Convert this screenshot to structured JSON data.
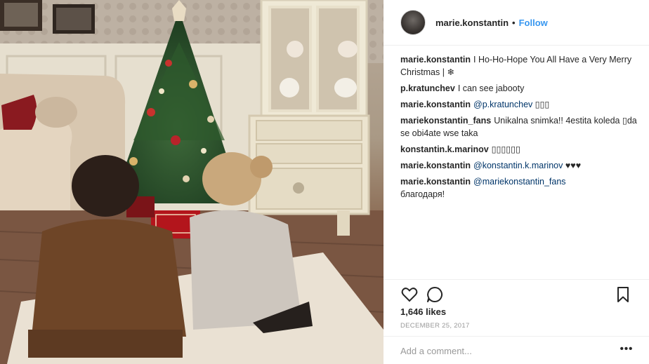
{
  "photo": {
    "caption": "",
    "icon": "photo-christmas-scene"
  },
  "header": {
    "username": "marie.konstantin",
    "separator": "•",
    "follow_label": "Follow",
    "follow_color": "#3897f0"
  },
  "comments": [
    {
      "user": "marie.konstantin",
      "mention": "",
      "text": "I Ho-Ho-Hope You All Have a Very Merry Christmas | ❄"
    },
    {
      "user": "p.kratunchev",
      "mention": "",
      "text": "I can see jabooty"
    },
    {
      "user": "marie.konstantin",
      "mention": "@p.kratunchev",
      "text": "▯▯▯"
    },
    {
      "user": "mariekonstantin_fans",
      "mention": "",
      "text": "Unikalna snimka!! 4estita koleda ▯da se obi4ate wse taka"
    },
    {
      "user": "konstantin.k.marinov",
      "mention": "",
      "text": "▯▯▯▯▯▯"
    },
    {
      "user": "marie.konstantin",
      "mention": "@konstantin.k.marinov",
      "text": "♥♥♥"
    },
    {
      "user": "marie.konstantin",
      "mention": "@mariekonstantin_fans",
      "text": "благодаря!"
    }
  ],
  "actions": {
    "like_icon": "heart-icon",
    "comment_icon": "comment-icon",
    "save_icon": "bookmark-icon",
    "likes": "1,646 likes",
    "date": "DECEMBER 25, 2017"
  },
  "add_comment": {
    "placeholder": "Add a comment...",
    "more_label": "•••"
  },
  "colors": {
    "link": "#003569",
    "muted": "#999999",
    "text": "#262626",
    "border": "#efefef"
  }
}
